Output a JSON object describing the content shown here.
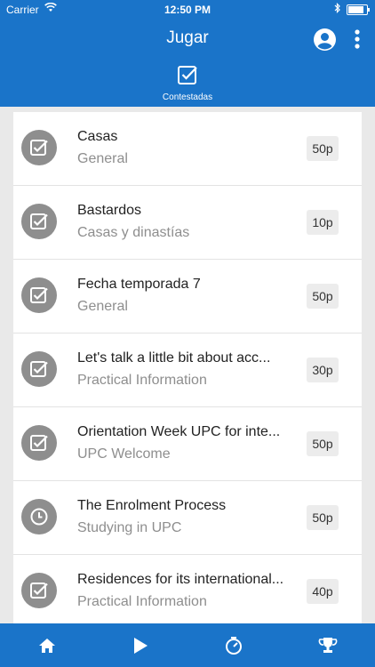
{
  "status_bar": {
    "carrier": "Carrier",
    "time": "12:50 PM"
  },
  "header": {
    "title": "Jugar",
    "tab_label": "Contestadas"
  },
  "items": [
    {
      "title": "Casas",
      "subtitle": "General",
      "points": "50p",
      "icon": "check-icon"
    },
    {
      "title": "Bastardos",
      "subtitle": "Casas y dinastías",
      "points": "10p",
      "icon": "check-icon"
    },
    {
      "title": "Fecha temporada 7",
      "subtitle": "General",
      "points": "50p",
      "icon": "check-icon"
    },
    {
      "title": "Let's talk a little bit about acc...",
      "subtitle": "Practical Information",
      "points": "30p",
      "icon": "check-icon"
    },
    {
      "title": "Orientation Week UPC for inte...",
      "subtitle": "UPC Welcome",
      "points": "50p",
      "icon": "check-icon"
    },
    {
      "title": "The Enrolment Process",
      "subtitle": "Studying in UPC",
      "points": "50p",
      "icon": "clock-icon"
    },
    {
      "title": "Residences for its international...",
      "subtitle": "Practical Information",
      "points": "40p",
      "icon": "check-icon"
    }
  ],
  "colors": {
    "primary": "#1a74c9",
    "icon_gray": "#8e8e8e",
    "badge_bg": "#ececec"
  },
  "tabbar": [
    "home-icon",
    "play-icon",
    "timer-icon",
    "trophy-icon"
  ]
}
